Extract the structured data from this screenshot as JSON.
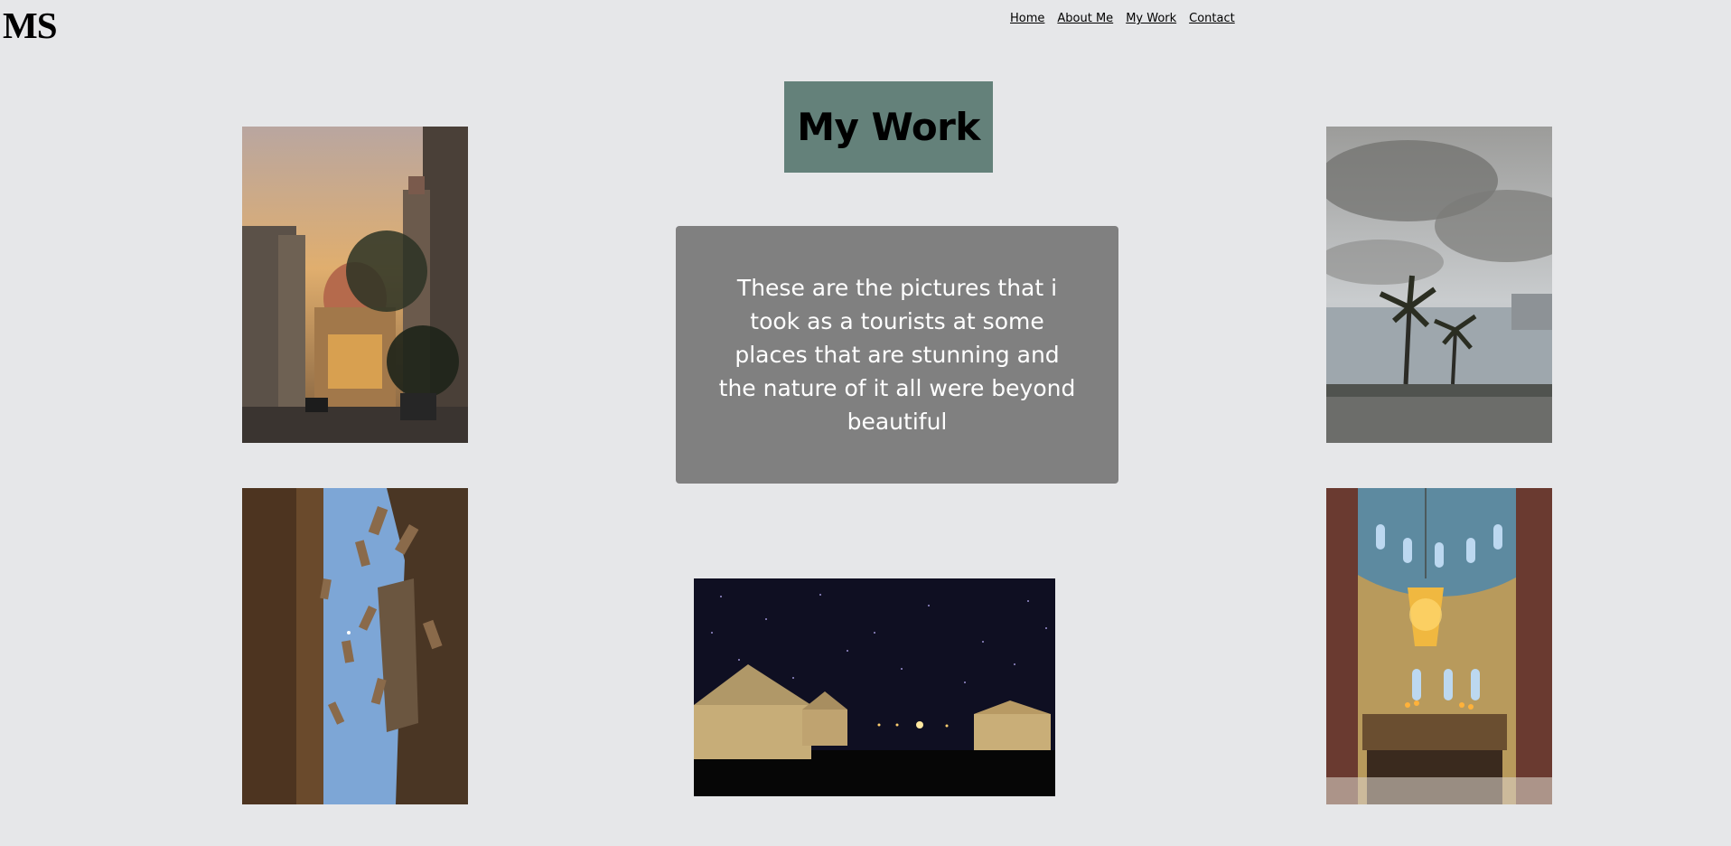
{
  "logo": "MS",
  "nav": {
    "home": "Home",
    "about": "About Me",
    "work": "My Work",
    "contact": "Contact"
  },
  "heading": "My Work",
  "description": "These are the pictures that i took as a tourists at some places that are stunning and the nature of it all were beyond beautiful",
  "colors": {
    "background": "#e6e7e9",
    "heading_box": "#64817a",
    "text_box": "#808080"
  },
  "photos": [
    {
      "name": "street-dome-sunset-photo"
    },
    {
      "name": "palm-trees-seafront-photo"
    },
    {
      "name": "alley-sky-hanging-flags-photo"
    },
    {
      "name": "church-interior-chandelier-photo"
    },
    {
      "name": "desert-tents-starry-night-photo"
    }
  ]
}
